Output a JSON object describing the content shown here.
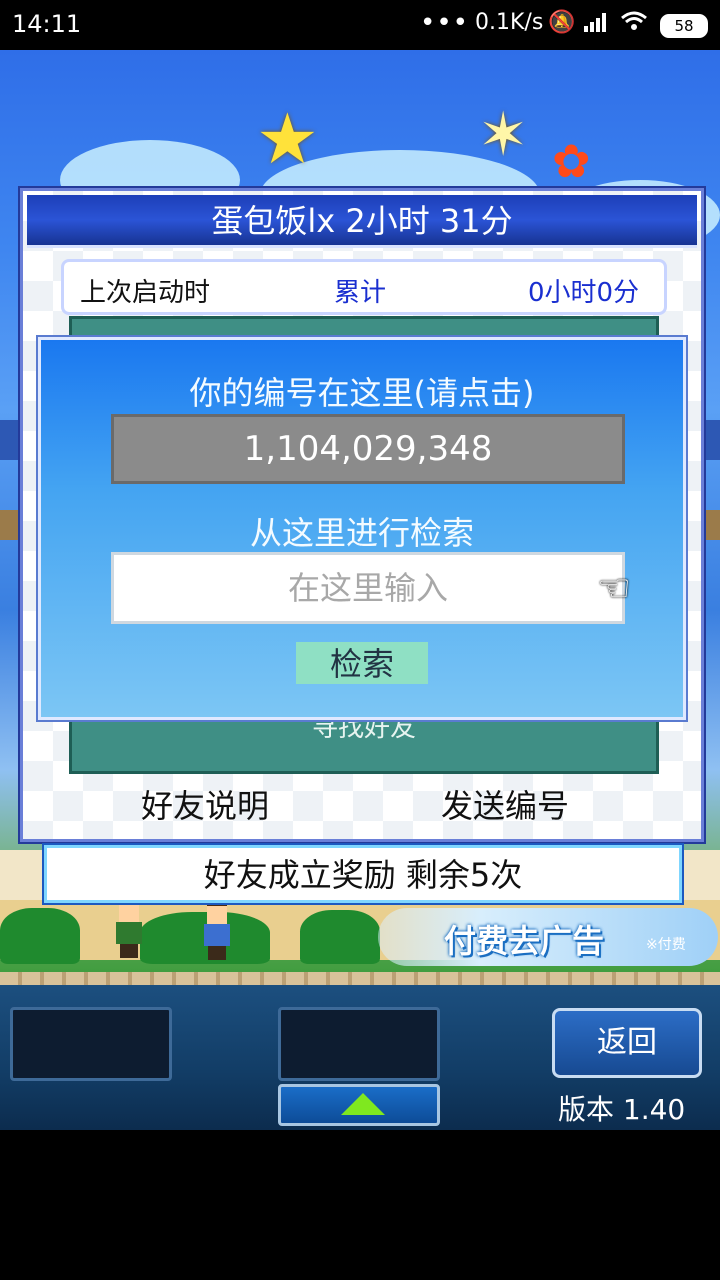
{
  "status_bar": {
    "time": "14:11",
    "dots": "•••",
    "net_speed": "0.1K/s",
    "battery": "58"
  },
  "dialog": {
    "title": "蛋包饭lx  2小时 31分",
    "last_launch_label": "上次启动时",
    "total_label": "累计",
    "total_value": "0小时0分",
    "find_friend": "寻找好友",
    "friend_help": "好友说明",
    "send_id": "发送编号"
  },
  "popup": {
    "title": "你的编号在这里(请点击)",
    "player_id": "1,104,029,348",
    "search_label": "从这里进行检索",
    "input_placeholder": "在这里输入",
    "search_button": "检索"
  },
  "reward_bar": "好友成立奖励  剩余5次",
  "ad_button": {
    "label": "付费去广告",
    "sub": "※付费"
  },
  "hud": {
    "back_button": "返回",
    "version": "版本 1.40"
  },
  "colors": {
    "title_bar": "#1d3fb8",
    "accent_blue": "#1a78f0",
    "panel_green": "#3f8f85",
    "search_button": "#8fe0c4",
    "total_text": "#1a2fd0"
  },
  "icons": [
    "signal-icon",
    "wifi-icon",
    "mute-icon",
    "hand-pointer-icon",
    "up-arrow-icon"
  ]
}
